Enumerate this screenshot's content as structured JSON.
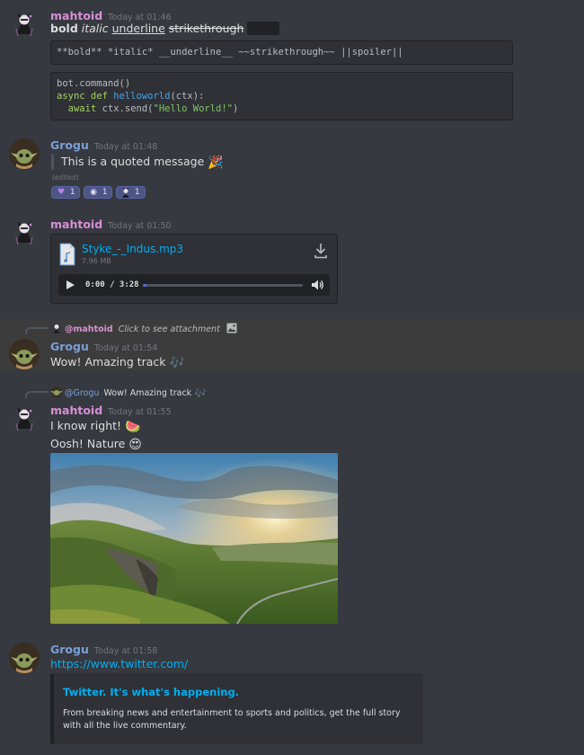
{
  "users": {
    "mahtoid": "mahtoid",
    "grogu": "Grogu"
  },
  "messages": [
    {
      "author": "mahtoid",
      "timestamp": "Today at 01:46",
      "formatted": {
        "bold": "bold",
        "italic": "italic",
        "underline": "underline",
        "strikethrough": "strikethrough"
      },
      "markdown_code": "**bold** *italic* __underline__ ~~strikethrough~~ ||spoiler||",
      "code_lines": [
        "bot.command()",
        "async def helloworld(ctx):",
        "  await ctx.send(\"Hello World!\")"
      ]
    },
    {
      "author": "Grogu",
      "timestamp": "Today at 01:48",
      "quote": "This is a quoted message",
      "edited": "(edited)",
      "reactions": [
        {
          "emoji": "purple-heart",
          "count": "1"
        },
        {
          "emoji": "eye",
          "count": "1"
        },
        {
          "emoji": "mahtoid-avatar",
          "count": "1"
        }
      ]
    },
    {
      "author": "mahtoid",
      "timestamp": "Today at 01:50",
      "attachment": {
        "file_name": "Styke_-_Indus.mp3",
        "file_size": "7.96 MB",
        "time": "0:00 / 3:28",
        "progress": 0.02
      }
    },
    {
      "author": "Grogu",
      "timestamp": "Today at 01:54",
      "reply_to": {
        "mention": "@mahtoid",
        "preview": "Click to see attachment"
      },
      "text": "Wow! Amazing track"
    },
    {
      "author": "mahtoid",
      "timestamp": "Today at 01:55",
      "reply_to": {
        "mention": "@Grogu",
        "preview": "Wow! Amazing track"
      },
      "lines": [
        "I know right!",
        "Oosh! Nature"
      ]
    },
    {
      "author": "Grogu",
      "timestamp": "Today at 01:58",
      "link": "https://www.twitter.com/",
      "embed": {
        "title": "Twitter. It's what's happening.",
        "description": "From breaking news and entertainment to sports and politics, get the full story with all the live commentary."
      }
    }
  ],
  "colors": {
    "background": "#36393f",
    "mahtoid": "#d790d5",
    "grogu": "#7b9fd8",
    "link": "#00aff4",
    "highlight": "#3d3c3c"
  }
}
